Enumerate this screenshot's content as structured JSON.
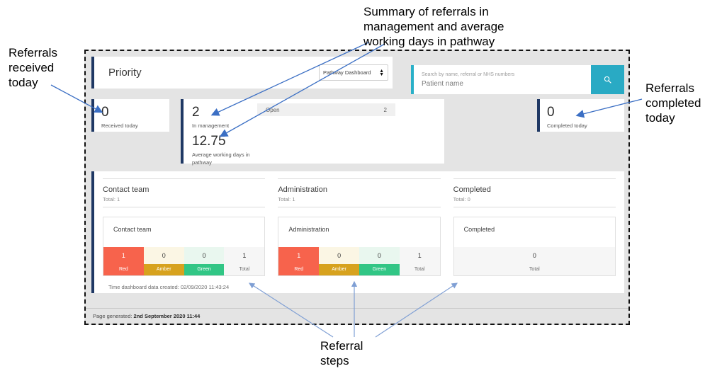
{
  "annotations": {
    "received": "Referrals\nreceived\ntoday",
    "summary": "Summary of referrals in\nmanagement and average\nworking days in pathway",
    "completed": "Referrals\ncompleted\ntoday",
    "steps": "Referral\nsteps"
  },
  "colors": {
    "accent_navy": "#1f3864",
    "teal": "#29aac4",
    "red": "#f7634c",
    "amber": "#d7a21e",
    "amber_light": "#fbf6e4",
    "green": "#31c685",
    "green_light": "#e9f7ef",
    "grey": "#f6f6f6"
  },
  "topbar": {
    "priority_title": "Priority",
    "dashboard_select": {
      "value": "Pathway Dashboard",
      "up_glyph": "▲",
      "down_glyph": "▼"
    },
    "search": {
      "label": "Search by name, referral or NHS numbers",
      "placeholder": "Patient name",
      "value": "",
      "button_icon": "search-icon"
    }
  },
  "metrics": {
    "received": {
      "value": "0",
      "label": "Received today"
    },
    "in_management": {
      "value": "2",
      "label": "In management"
    },
    "avg_days": {
      "value": "12.75",
      "label": "Average working days in pathway"
    },
    "open_bar": {
      "label": "Open",
      "value": "2"
    },
    "completed": {
      "value": "0",
      "label": "Completed today"
    }
  },
  "steps": [
    {
      "title": "Contact team",
      "total_label": "Total: 1",
      "card_title": "Contact team",
      "cells": [
        {
          "num": "1",
          "label": "Red"
        },
        {
          "num": "0",
          "label": "Amber"
        },
        {
          "num": "0",
          "label": "Green"
        },
        {
          "num": "1",
          "label": "Total"
        }
      ]
    },
    {
      "title": "Administration",
      "total_label": "Total: 1",
      "card_title": "Administration",
      "cells": [
        {
          "num": "1",
          "label": "Red"
        },
        {
          "num": "0",
          "label": "Amber"
        },
        {
          "num": "0",
          "label": "Green"
        },
        {
          "num": "1",
          "label": "Total"
        }
      ]
    },
    {
      "title": "Completed",
      "total_label": "Total: 0",
      "card_title": "Completed",
      "cells": [
        {
          "num": "0",
          "label": "Total"
        }
      ]
    }
  ],
  "data_created": "Time dashboard data created: 02/09/2020 11:43:24",
  "footer": {
    "prefix": "Page generated: ",
    "timestamp": "2nd September 2020 11:44"
  }
}
